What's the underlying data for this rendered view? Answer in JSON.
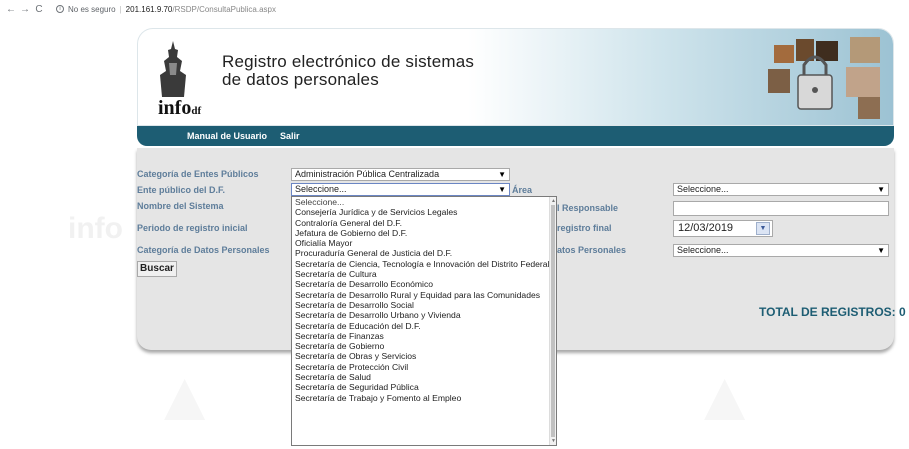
{
  "browser": {
    "back_icon": "arrow-left-icon",
    "forward_icon": "arrow-right-icon",
    "reload_icon": "reload-icon",
    "security_text": "No es seguro",
    "url_host": "201.161.9.70",
    "url_path": "/RSDP/ConsultaPublica.aspx"
  },
  "header": {
    "logo_text": "info",
    "logo_sub": "df",
    "title_line1": "Registro electrónico de sistemas",
    "title_line2": "de datos personales"
  },
  "nav": {
    "manual_label": "Manual de Usuario",
    "salir_label": "Salir"
  },
  "form": {
    "categoria_entes_label": "Categoría de Entes Públicos",
    "categoria_entes_value": "Administración Pública Centralizada",
    "ente_publico_label": "Ente público del D.F.",
    "ente_publico_value": "Seleccione...",
    "area_label": "Área",
    "area_value": "Seleccione...",
    "nombre_sistema_label": "Nombre del Sistema",
    "responsable_label": "l Responsable",
    "periodo_label": "Periodo de registro inicial",
    "registro_final_label": "registro final",
    "registro_final_value": "12/03/2019",
    "categoria_datos_label": "Categoría de Datos Personales",
    "datos_personales_label": "atos Personales",
    "datos_personales_value": "Seleccione...",
    "buscar_label": "Buscar",
    "total_label": "TOTAL DE REGISTROS: 0"
  },
  "dropdown": {
    "selected_index": 21,
    "items": [
      "Seleccione...",
      "Consejería Jurídica y de Servicios Legales",
      "Contraloría General del D.F.",
      "Jefatura de Gobierno del D.F.",
      "Oficialía Mayor",
      "Procuraduría General de Justicia del D.F.",
      "Secretaría de Ciencia, Tecnología e Innovación del Distrito Federal",
      "Secretaría de Cultura",
      "Secretaría de Desarrollo Económico",
      "Secretaría de Desarrollo Rural y Equidad para las Comunidades",
      "Secretaría de Desarrollo Social",
      "Secretaría de Desarrollo Urbano y Vivienda",
      "Secretaría de Educación del D.F.",
      "Secretaría de Finanzas",
      "Secretaría de Gobierno",
      "Secretaría de Obras y Servicios",
      "Secretaría de Protección Civil",
      "Secretaría de Salud",
      "Secretaría de Seguridad Pública",
      "Secretaría de Trabajo y Fomento al Empleo"
    ]
  },
  "colors": {
    "nav_bg": "#1d5d73",
    "label_color": "#5e7d9a",
    "selected_bg": "#1e6fe0",
    "panel_bg": "#e5e5e5"
  }
}
